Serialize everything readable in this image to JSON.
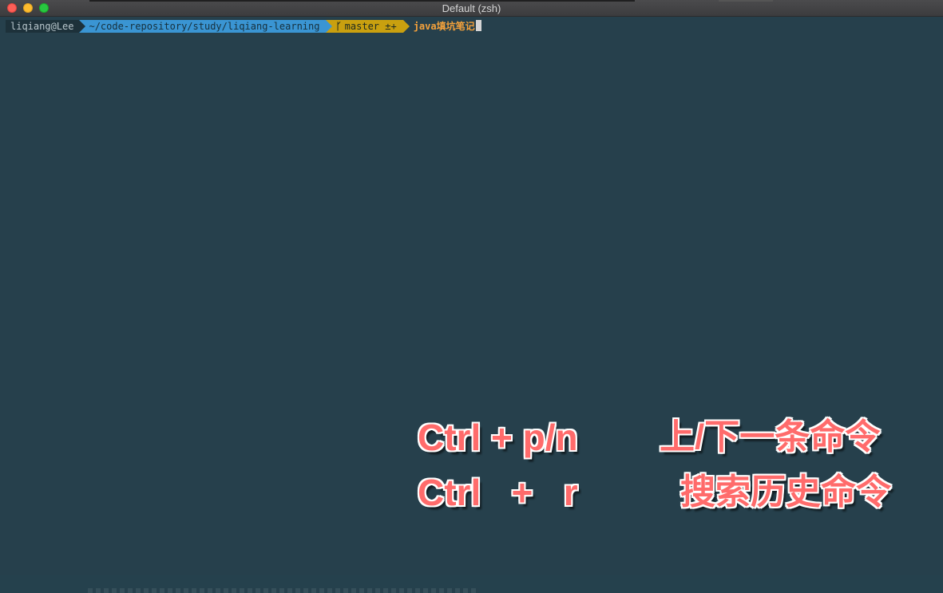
{
  "window": {
    "title": "Default (zsh)"
  },
  "prompt": {
    "user_host": "liqiang@Lee",
    "path": "~/code-repository/study/liqiang-learning",
    "git_branch_icon": "git-branch-icon",
    "git_branch_glyph": "ᚴ",
    "git_branch": "master ±+",
    "current_dir": "java填坑笔记"
  },
  "overlay": {
    "line1_keys": "Ctrl + p/n",
    "line1_desc": "上/下一条命令",
    "line2_keys": "Ctrl   +   r",
    "line2_desc": "搜索历史命令"
  },
  "colors": {
    "terminal_bg": "#26404c",
    "path_segment": "#3a95d3",
    "git_segment": "#c9a00f",
    "command_text": "#f4a13b",
    "overlay_text": "#ff6b6b"
  }
}
